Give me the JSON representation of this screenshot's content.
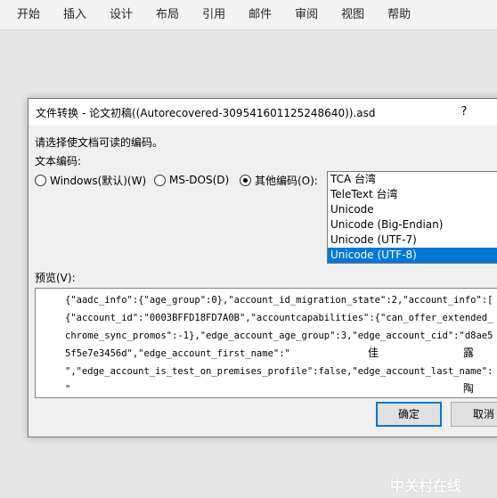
{
  "menubar": {
    "items": [
      "开始",
      "插入",
      "设计",
      "布局",
      "引用",
      "邮件",
      "审阅",
      "视图",
      "帮助"
    ]
  },
  "dialog": {
    "title": "文件转换 - 论文初稿((Autorecovered-309541601125248640)).asd",
    "help": "?",
    "instruction": "请选择使文档可读的编码。",
    "encoding_label": "文本编码:",
    "radios": [
      {
        "label": "Windows(默认)(W)",
        "checked": false
      },
      {
        "label": "MS-DOS(D)",
        "checked": false
      },
      {
        "label": "其他编码(O):",
        "checked": true
      }
    ],
    "encodings": [
      {
        "label": "TCA 台湾",
        "selected": false
      },
      {
        "label": "TeleText 台湾",
        "selected": false
      },
      {
        "label": "Unicode",
        "selected": false
      },
      {
        "label": "Unicode (Big-Endian)",
        "selected": false
      },
      {
        "label": "Unicode (UTF-7)",
        "selected": false
      },
      {
        "label": "Unicode (UTF-8)",
        "selected": true
      }
    ],
    "preview_label": "预览(V):",
    "preview_lines": [
      "{\"aadc_info\":{\"age_group\":0},\"account_id_migration_state\":2,\"account_info\":[",
      "{\"account_id\":\"0003BFFD18FD7A0B\",\"accountcapabilities\":{\"can_offer_extended_",
      "chrome_sync_promos\":-1},\"edge_account_age_group\":3,\"edge_account_cid\":\"d8ae5",
      "5f5e7e3456d\",\"edge_account_first_name\":\"",
      "\",\"edge_account_is_test_on_premises_profile\":false,\"edge_account_last_name\":",
      "\""
    ],
    "preview_extra": {
      "first_name_char1": "佳",
      "first_name_char2": "露",
      "last_name_char": "陶"
    },
    "ok_label": "确定",
    "cancel_label": "取消"
  },
  "watermark": "中关村在线"
}
